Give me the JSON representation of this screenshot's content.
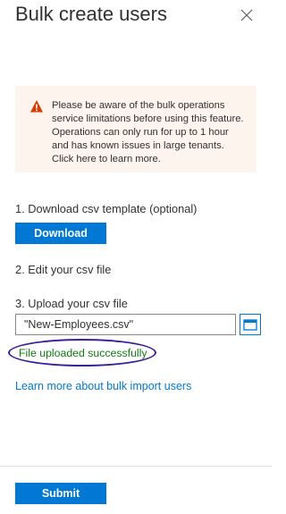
{
  "panel": {
    "title": "Bulk create users",
    "close_icon": "close-icon"
  },
  "notice": {
    "icon": "warning-icon",
    "text": "Please be aware of the bulk operations service limitations before using this feature. Operations can only run for up to 1 hour and has known issues in large tenants. Click here to learn more."
  },
  "steps": {
    "download_label": "1. Download csv template (optional)",
    "download_button": "Download",
    "edit_label": "2. Edit your csv file",
    "upload_label": "3. Upload your csv file"
  },
  "upload": {
    "file_value": "\"New-Employees.csv\"",
    "browse_icon": "folder-icon",
    "status": "File uploaded successfully"
  },
  "learn_more_link": "Learn more about bulk import users",
  "footer": {
    "submit_button": "Submit"
  },
  "colors": {
    "accent": "#0078d4",
    "success": "#107c10",
    "warning": "#d83b01",
    "highlight_ellipse": "#3b1f9b"
  }
}
